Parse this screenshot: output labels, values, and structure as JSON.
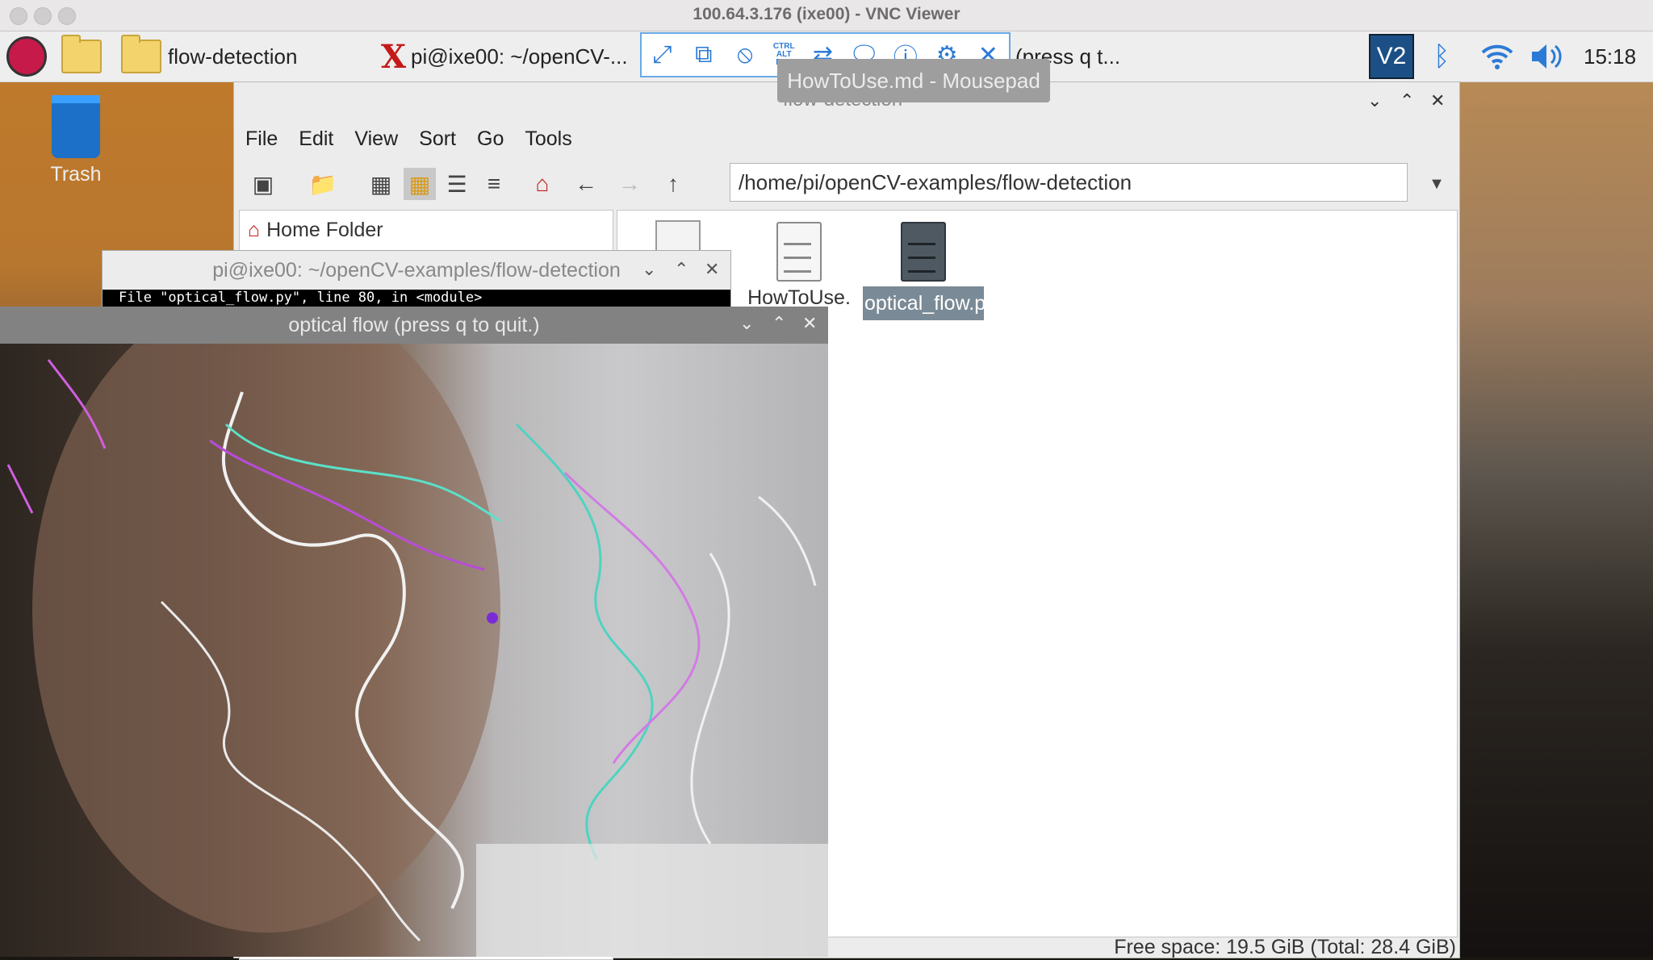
{
  "mac_window": {
    "title": "100.64.3.176 (ixe00) - VNC Viewer"
  },
  "taskbar": {
    "folder_label": "flow-detection",
    "terminal_label": "pi@ixe00: ~/openCV-...",
    "flow_label": "(press q t...",
    "clock": "15:18",
    "vnc_badge": "V2"
  },
  "vnc_toolbar": {
    "tooltip": "HowToUse.md - Mousepad",
    "buttons": [
      "fullscreen-icon",
      "scale-icon",
      "mute-icon",
      "ctrl-alt-del-icon",
      "transfer-icon",
      "chat-icon",
      "info-icon",
      "settings-icon",
      "close-icon"
    ],
    "ctrl_alt_del_text": "CTRL ALT DEL"
  },
  "file_manager": {
    "title": "flow-detection",
    "menu": [
      "File",
      "Edit",
      "View",
      "Sort",
      "Go",
      "Tools"
    ],
    "path": "/home/pi/openCV-examples/flow-detection",
    "sidebar_home": "Home Folder",
    "files": [
      {
        "name": "HowToUse.",
        "icon": "text-file-icon"
      },
      {
        "name": "optical_flow.py",
        "icon": "script-file-icon"
      }
    ],
    "status": "Free space: 19.5 GiB (Total: 28.4 GiB)"
  },
  "desktop": {
    "trash_label": "Trash"
  },
  "terminal": {
    "title": "pi@ixe00: ~/openCV-examples/flow-detection",
    "line": "File \"optical_flow.py\", line 80, in <module>"
  },
  "flow_window": {
    "title": "optical flow (press q to quit.)"
  },
  "colors": {
    "accent": "#2b7bd6",
    "selection": "#7a8a96"
  }
}
